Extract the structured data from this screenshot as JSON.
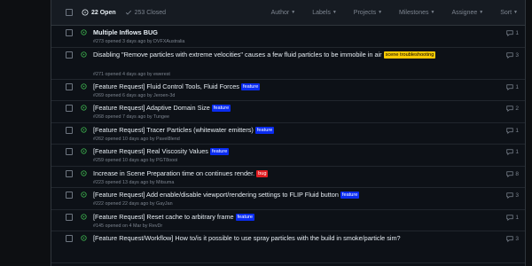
{
  "header": {
    "open_label": "22 Open",
    "closed_label": "253 Closed",
    "filters": [
      "Author",
      "Labels",
      "Projects",
      "Milestones",
      "Assignee",
      "Sort"
    ]
  },
  "colors": {
    "open_green": "#3fb950",
    "label_feature": "#0a2cf0",
    "label_bug": "#e11d21",
    "label_scene": "#fbca04"
  },
  "issues": [
    {
      "title": "Multiple Inflows BUG",
      "meta": "#273 opened 3 days ago by DVFXAustralia",
      "comments": "1",
      "labels": []
    },
    {
      "title": "Disabling \"Remove particles with extreme velocities\" causes a few fluid particles to be immobile in air",
      "meta": "#271 opened 4 days ago by ewerest",
      "comments": "3",
      "labels": [
        {
          "text": "scene troubleshooting",
          "kind": "scene"
        }
      ]
    },
    {
      "title": "[Feature Request] Fluid Control Tools, Fluid Forces",
      "meta": "#269 opened 6 days ago by Jeroen-3d",
      "comments": "1",
      "labels": [
        {
          "text": "feature",
          "kind": "feature"
        }
      ]
    },
    {
      "title": "[Feature Request] Adaptive Domain Size",
      "meta": "#268 opened 7 days ago by Tungee",
      "comments": "2",
      "labels": [
        {
          "text": "feature",
          "kind": "feature"
        }
      ]
    },
    {
      "title": "[Feature Request] Tracer Particles (whitewater emitters)",
      "meta": "#262 opened 10 days ago by Pavel8lend",
      "comments": "1",
      "labels": [
        {
          "text": "feature",
          "kind": "feature"
        }
      ]
    },
    {
      "title": "[Feature Request] Real Viscosity Values",
      "meta": "#259 opened 10 days ago by PGT8oooi",
      "comments": "1",
      "labels": [
        {
          "text": "feature",
          "kind": "feature"
        }
      ]
    },
    {
      "title": "Increase in Scene Preparation time on continues render.",
      "meta": "#223 opened 13 days ago by Mitsuma",
      "comments": "8",
      "labels": [
        {
          "text": "bug",
          "kind": "bug"
        }
      ]
    },
    {
      "title": "[Feature Request] Add enable/disable viewport/rendering settings to FLIP Fluid button",
      "meta": "#222 opened 22 days ago by GayJan",
      "comments": "3",
      "labels": [
        {
          "text": "feature",
          "kind": "feature"
        }
      ]
    },
    {
      "title": "[Feature Request] Reset cache to arbitrary frame",
      "meta": "#145 opened on 4 Mar by RevDr",
      "comments": "1",
      "labels": [
        {
          "text": "feature",
          "kind": "feature"
        }
      ]
    },
    {
      "title": "[Feature Request/Workflow] How to/is it possible to use spray particles with the build in smoke/particle sim?",
      "meta": "",
      "comments": "3",
      "labels": []
    }
  ]
}
